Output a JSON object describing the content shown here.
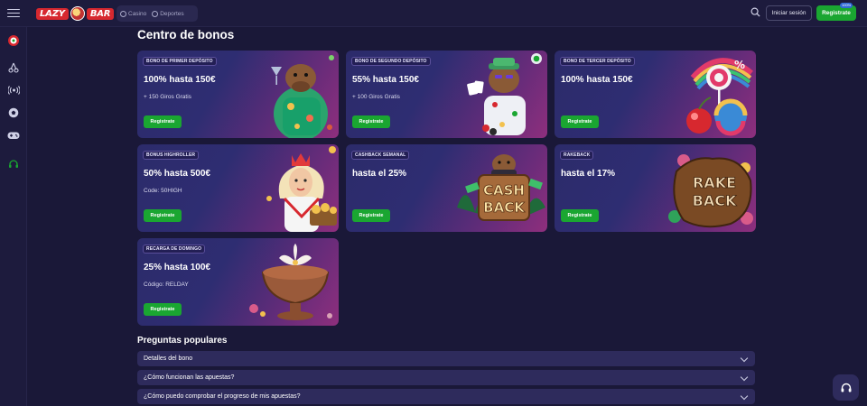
{
  "header": {
    "logo_text_left": "LAZY",
    "logo_text_right": "BAR",
    "tabs": [
      {
        "label": "Casino",
        "icon": "cards-icon"
      },
      {
        "label": "Deportes",
        "icon": "ball-icon"
      }
    ],
    "login_label": "Iniciar sesión",
    "register_label": "Registrate",
    "register_badge": "100%"
  },
  "sidebar": {
    "items": [
      "wheel-icon",
      "cherries-icon",
      "live-icon",
      "football-icon",
      "gamepad-icon",
      "support-icon"
    ]
  },
  "main": {
    "title": "Centro de bonos",
    "cards": [
      {
        "tag": "BONO DE PRIMER DEPÓSITO",
        "headline": "100% hasta 150€",
        "sub": "+ 150 Giros Gratis",
        "cta": "Registrate",
        "art": "capybara-hawaiian"
      },
      {
        "tag": "BONO DE SEGUNDO DEPÓSITO",
        "headline": "55% hasta 150€",
        "sub": "+ 100 Giros Gratis",
        "cta": "Registrate",
        "art": "capybara-poker"
      },
      {
        "tag": "BONO DE TERCER DEPÓSITO",
        "headline": "100% hasta 150€",
        "sub": "",
        "cta": "Registrate",
        "art": "candy-cherry"
      },
      {
        "tag": "BONUS HIGHROLLER",
        "headline": "50% hasta 500€",
        "sub": "Code: 50HIGH",
        "cta": "Registrate",
        "art": "queen-gold"
      },
      {
        "tag": "CASHBACK SEMANAL",
        "headline": "hasta el 25%",
        "sub": "",
        "cta": "Registrate",
        "art": "cashback-sign"
      },
      {
        "tag": "RAKEBACK",
        "headline": "hasta el 17%",
        "sub": "",
        "cta": "Registrate",
        "art": "rakeback-sign"
      },
      {
        "tag": "RECARGA DE DOMINGO",
        "headline": "25% hasta 100€",
        "sub": "Código: RELDAY",
        "cta": "Registrate",
        "art": "flower-bowl"
      }
    ],
    "art_text": {
      "cash": "CASH",
      "back": "BACK",
      "rake": "RAKE",
      "back2": "BACK"
    }
  },
  "faq": {
    "title": "Preguntas populares",
    "items": [
      "Detalles del bono",
      "¿Cómo funcionan las apuestas?",
      "¿Cómo puedo comprobar el progreso de mis apuestas?"
    ]
  },
  "colors": {
    "background": "#1a1838",
    "accent_green": "#1aa631",
    "card_purple": "#2e2d72",
    "card_magenta": "#8e2f7d"
  }
}
